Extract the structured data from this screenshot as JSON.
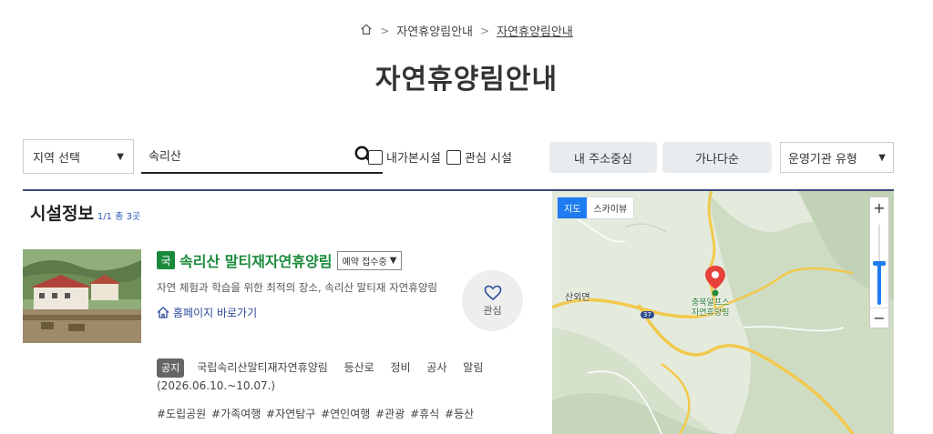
{
  "breadcrumb": {
    "level1": "자연휴양림안내",
    "level2": "자연휴양림안내"
  },
  "page_title": "자연휴양림안내",
  "filters": {
    "region_select": "지역 선택",
    "search_value": "속리산",
    "check_visited": "내가본시설",
    "check_interest": "관심 시설",
    "btn_near": "내 주소중심",
    "btn_sort": "가나다순",
    "type_select": "운영기관 유형"
  },
  "facility": {
    "section_title": "시설정보",
    "count": "1/1 총 3곳",
    "badge": "국",
    "name": "속리산 말티재자연휴양림",
    "reserve_status": "예약 접수중",
    "description": "자연 체험과 학습을 위한 최적의 장소, 속리산 말티재 자연휴양림",
    "homepage_link": "홈페이지 바로가기",
    "notice_badge": "공지",
    "notice_text": "국립속리산말티재자연휴양림 등산로 정비 공사 알림 (2026.06.10.~10.07.)",
    "tags": "#도립공원 #가족여행 #자연탐구 #연인여행 #관광 #휴식 #등산",
    "fav_label": "관심"
  },
  "map": {
    "toggle_map": "지도",
    "toggle_sky": "스카이뷰",
    "zoom_in": "+",
    "zoom_out": "−",
    "zoom_level": 0.45,
    "label_town": "산외면",
    "route_no": "37",
    "poi_line1": "충북알프스",
    "poi_line2": "자연휴양림"
  },
  "colors": {
    "accent_green": "#1a8a3a",
    "accent_blue": "#1f7cf0",
    "divider": "#3b4a7a",
    "marker": "#e8413c"
  }
}
